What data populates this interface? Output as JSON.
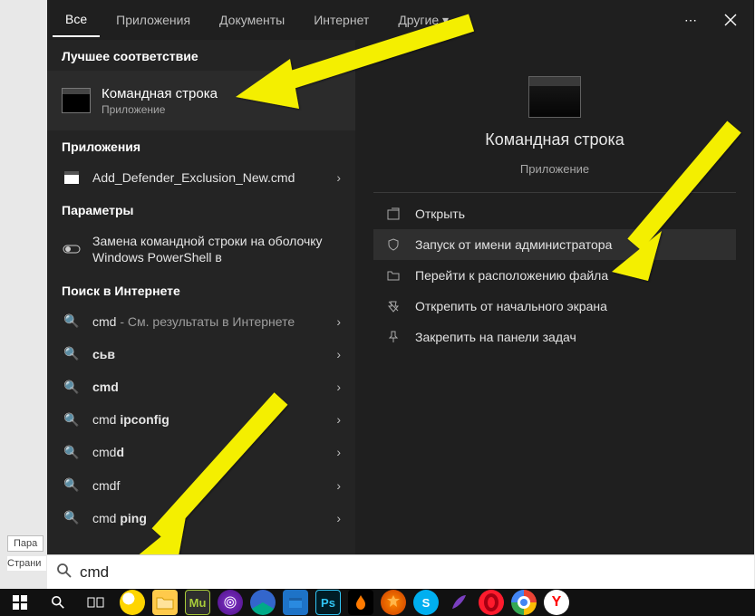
{
  "tabs": {
    "all": "Все",
    "apps": "Приложения",
    "docs": "Документы",
    "web": "Интернет",
    "more": "Другие"
  },
  "left": {
    "best_header": "Лучшее соответствие",
    "best_title": "Командная строка",
    "best_sub": "Приложение",
    "apps_header": "Приложения",
    "app1": "Add_Defender_Exclusion_New.cmd",
    "params_header": "Параметры",
    "param1": "Замена командной строки на оболочку Windows PowerShell в",
    "websearch_header": "Поиск в Интернете",
    "s1_prefix": "cmd",
    "s1_suffix": " - См. результаты в Интернете",
    "s2": "сьв",
    "s3": "cmd",
    "s4_a": "cmd ",
    "s4_b": "ipconfig",
    "s5_a": "cmd",
    "s5_b": "d",
    "s6": "cmdf",
    "s7_a": "cmd ",
    "s7_b": "ping"
  },
  "right": {
    "title": "Командная строка",
    "sub": "Приложение",
    "a_open": "Открыть",
    "a_admin": "Запуск от имени администратора",
    "a_loc": "Перейти к расположению файла",
    "a_unpin": "Открепить от начального экрана",
    "a_pin": "Закрепить на панели задач"
  },
  "search": {
    "value": "cmd",
    "placeholder": ""
  },
  "behind": {
    "tip1": "Пара",
    "tip2": "Страни"
  }
}
